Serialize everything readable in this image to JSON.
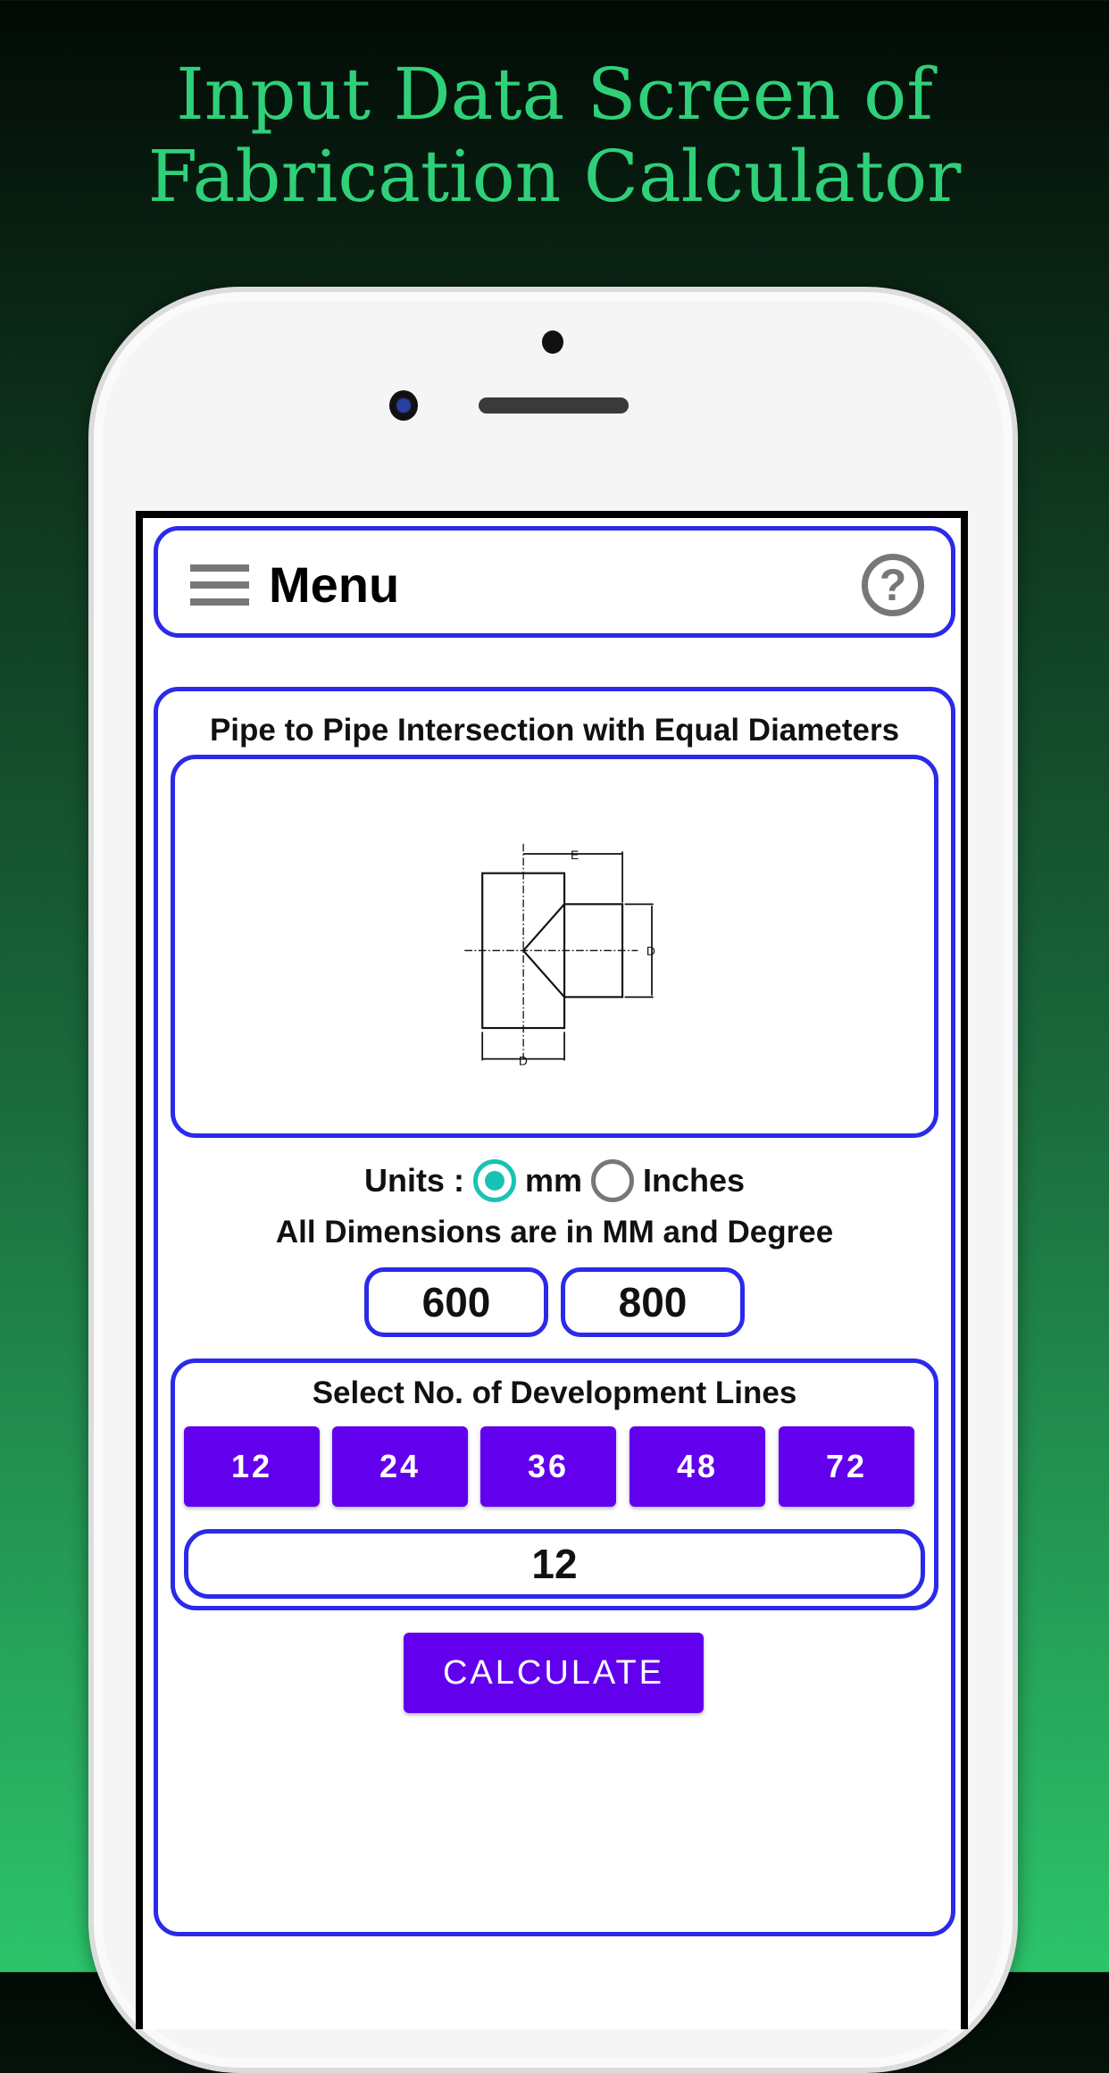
{
  "headline": {
    "line1": "Input Data Screen of",
    "line2": "Fabrication Calculator"
  },
  "header": {
    "title": "Menu",
    "menu_icon": "hamburger-icon",
    "help_icon": "help-circle-icon",
    "help_glyph": "?"
  },
  "card": {
    "title": "Pipe to Pipe Intersection with Equal Diameters",
    "diagram_labels": {
      "e": "E",
      "d_right": "D",
      "d_bottom": "D"
    },
    "units": {
      "label": "Units :",
      "options": [
        {
          "label": "mm",
          "selected": true
        },
        {
          "label": "Inches",
          "selected": false
        }
      ]
    },
    "dimensions_note": "All Dimensions are in MM and Degree",
    "inputs": [
      "600",
      "800"
    ],
    "development": {
      "title": "Select No. of Development Lines",
      "options": [
        "12",
        "24",
        "36",
        "48",
        "72"
      ],
      "value": "12"
    },
    "calculate_label": "CALCULATE"
  },
  "colors": {
    "accent": "#6200ee",
    "border": "#2a2ae8",
    "radio": "#19c3b3",
    "headline": "#2fd079"
  }
}
